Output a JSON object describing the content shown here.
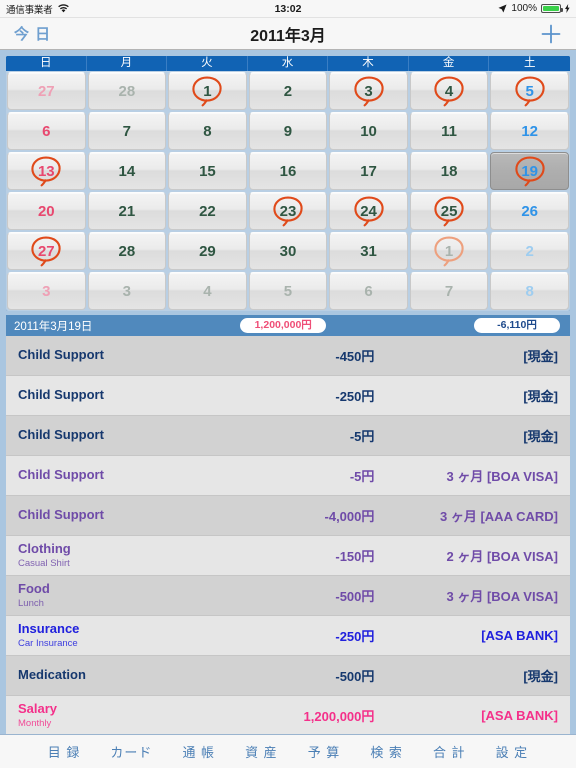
{
  "status_bar": {
    "carrier": "通信事業者",
    "wifi_icon": "wifi-icon",
    "time": "13:02",
    "location_icon": "location-arrow-icon",
    "battery_percent": "100%",
    "battery_icon": "battery-full-icon",
    "charging_icon": "charging-bolt-icon"
  },
  "nav": {
    "today_label": "今 日",
    "title": "2011年3月",
    "add_icon": "plus-icon"
  },
  "calendar": {
    "weekday_headers": [
      "日",
      "月",
      "火",
      "水",
      "木",
      "金",
      "土"
    ],
    "weeks": [
      [
        {
          "num": "27",
          "tone": "sun-dim",
          "circled": false,
          "selected": false
        },
        {
          "num": "28",
          "tone": "wk-dim",
          "circled": false,
          "selected": false
        },
        {
          "num": "1",
          "tone": "wk",
          "circled": true,
          "selected": false
        },
        {
          "num": "2",
          "tone": "wk",
          "circled": false,
          "selected": false
        },
        {
          "num": "3",
          "tone": "wk",
          "circled": true,
          "selected": false
        },
        {
          "num": "4",
          "tone": "wk",
          "circled": true,
          "selected": false
        },
        {
          "num": "5",
          "tone": "sat",
          "circled": true,
          "selected": false
        }
      ],
      [
        {
          "num": "6",
          "tone": "sun",
          "circled": false,
          "selected": false
        },
        {
          "num": "7",
          "tone": "wk",
          "circled": false,
          "selected": false
        },
        {
          "num": "8",
          "tone": "wk",
          "circled": false,
          "selected": false
        },
        {
          "num": "9",
          "tone": "wk",
          "circled": false,
          "selected": false
        },
        {
          "num": "10",
          "tone": "wk",
          "circled": false,
          "selected": false
        },
        {
          "num": "11",
          "tone": "wk",
          "circled": false,
          "selected": false
        },
        {
          "num": "12",
          "tone": "sat",
          "circled": false,
          "selected": false
        }
      ],
      [
        {
          "num": "13",
          "tone": "sun",
          "circled": true,
          "selected": false
        },
        {
          "num": "14",
          "tone": "wk",
          "circled": false,
          "selected": false
        },
        {
          "num": "15",
          "tone": "wk",
          "circled": false,
          "selected": false
        },
        {
          "num": "16",
          "tone": "wk",
          "circled": false,
          "selected": false
        },
        {
          "num": "17",
          "tone": "wk",
          "circled": false,
          "selected": false
        },
        {
          "num": "18",
          "tone": "wk",
          "circled": false,
          "selected": false
        },
        {
          "num": "19",
          "tone": "sat",
          "circled": true,
          "selected": true
        }
      ],
      [
        {
          "num": "20",
          "tone": "sun",
          "circled": false,
          "selected": false
        },
        {
          "num": "21",
          "tone": "wk",
          "circled": false,
          "selected": false
        },
        {
          "num": "22",
          "tone": "wk",
          "circled": false,
          "selected": false
        },
        {
          "num": "23",
          "tone": "wk",
          "circled": true,
          "selected": false
        },
        {
          "num": "24",
          "tone": "wk",
          "circled": true,
          "selected": false
        },
        {
          "num": "25",
          "tone": "wk",
          "circled": true,
          "selected": false
        },
        {
          "num": "26",
          "tone": "sat",
          "circled": false,
          "selected": false
        }
      ],
      [
        {
          "num": "27",
          "tone": "sun",
          "circled": true,
          "selected": false
        },
        {
          "num": "28",
          "tone": "wk",
          "circled": false,
          "selected": false
        },
        {
          "num": "29",
          "tone": "wk",
          "circled": false,
          "selected": false
        },
        {
          "num": "30",
          "tone": "wk",
          "circled": false,
          "selected": false
        },
        {
          "num": "31",
          "tone": "wk",
          "circled": false,
          "selected": false
        },
        {
          "num": "1",
          "tone": "wk-dim",
          "circled": true,
          "circle_dim": true,
          "selected": false
        },
        {
          "num": "2",
          "tone": "sat-dim",
          "circled": false,
          "selected": false
        }
      ],
      [
        {
          "num": "3",
          "tone": "sun-dim",
          "circled": false,
          "selected": false
        },
        {
          "num": "3",
          "tone": "wk-dim",
          "circled": false,
          "selected": false
        },
        {
          "num": "4",
          "tone": "wk-dim",
          "circled": false,
          "selected": false
        },
        {
          "num": "5",
          "tone": "wk-dim",
          "circled": false,
          "selected": false
        },
        {
          "num": "6",
          "tone": "wk-dim",
          "circled": false,
          "selected": false
        },
        {
          "num": "7",
          "tone": "wk-dim",
          "circled": false,
          "selected": false
        },
        {
          "num": "8",
          "tone": "sat-dim",
          "circled": false,
          "selected": false
        }
      ]
    ],
    "selected_date_index": {
      "week": 2,
      "day": 6
    }
  },
  "summary": {
    "date": "2011年3月19日",
    "income_total": "1,200,000円",
    "expense_total": "-6,110円"
  },
  "transactions": [
    {
      "category": "Child Support",
      "memo": "",
      "amount": "-450円",
      "payment": "[現金]",
      "tone": "cash",
      "shade": "plain"
    },
    {
      "category": "Child Support",
      "memo": "",
      "amount": "-250円",
      "payment": "[現金]",
      "tone": "cash",
      "shade": "alt"
    },
    {
      "category": "Child Support",
      "memo": "",
      "amount": "-5円",
      "payment": "[現金]",
      "tone": "cash",
      "shade": "plain"
    },
    {
      "category": "Child Support",
      "memo": "",
      "amount": "-5円",
      "payment": "3 ヶ月 [BOA VISA]",
      "tone": "card",
      "shade": "alt"
    },
    {
      "category": "Child Support",
      "memo": "",
      "amount": "-4,000円",
      "payment": "3 ヶ月 [AAA CARD]",
      "tone": "card",
      "shade": "plain"
    },
    {
      "category": "Clothing",
      "memo": "Casual Shirt",
      "amount": "-150円",
      "payment": "2 ヶ月 [BOA VISA]",
      "tone": "card",
      "shade": "alt"
    },
    {
      "category": "Food",
      "memo": "Lunch",
      "amount": "-500円",
      "payment": "3 ヶ月 [BOA VISA]",
      "tone": "card",
      "shade": "plain"
    },
    {
      "category": "Insurance",
      "memo": "Car Insurance",
      "amount": "-250円",
      "payment": "[ASA BANK]",
      "tone": "bank",
      "shade": "alt"
    },
    {
      "category": "Medication",
      "memo": "",
      "amount": "-500円",
      "payment": "[現金]",
      "tone": "cash",
      "shade": "plain"
    },
    {
      "category": "Salary",
      "memo": "Monthly",
      "amount": "1,200,000円",
      "payment": "[ASA BANK]",
      "tone": "inc",
      "shade": "alt"
    }
  ],
  "tabs": [
    {
      "label": "目 録"
    },
    {
      "label": "カード"
    },
    {
      "label": "通 帳"
    },
    {
      "label": "資 産"
    },
    {
      "label": "予 算"
    },
    {
      "label": "検 索"
    },
    {
      "label": "合 計"
    },
    {
      "label": "設 定"
    }
  ],
  "colors": {
    "nav_blue": "#5b93cc",
    "header_blue": "#1163b4",
    "summary_blue": "#5089bd",
    "page_bg": "#aac6e0",
    "circle_orange": "#e04a1a",
    "cash_navy": "#16386e",
    "card_purple": "#6f4ba8",
    "bank_blue": "#2020dd",
    "income_pink": "#f4308a"
  }
}
